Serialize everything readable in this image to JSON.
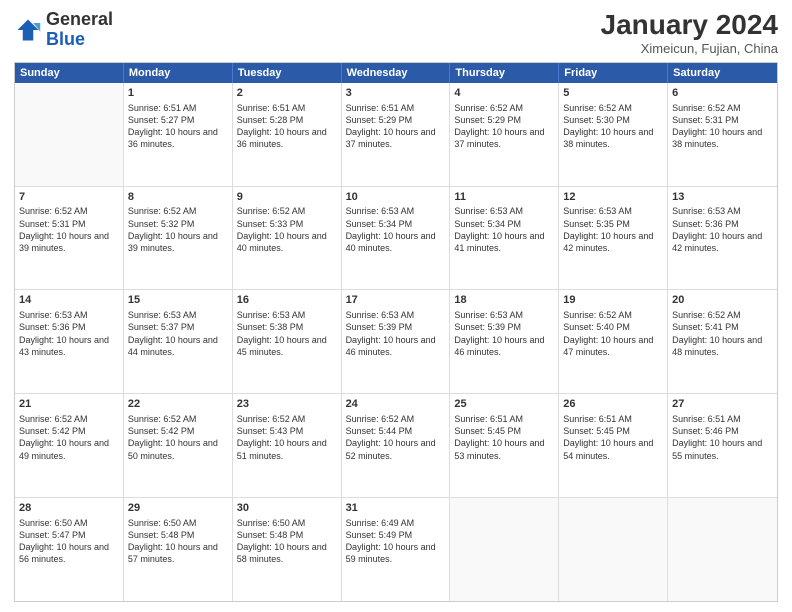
{
  "header": {
    "logo_general": "General",
    "logo_blue": "Blue",
    "month_year": "January 2024",
    "location": "Ximeicun, Fujian, China"
  },
  "weekdays": [
    "Sunday",
    "Monday",
    "Tuesday",
    "Wednesday",
    "Thursday",
    "Friday",
    "Saturday"
  ],
  "rows": [
    [
      {
        "day": "",
        "sunrise": "",
        "sunset": "",
        "daylight": ""
      },
      {
        "day": "1",
        "sunrise": "Sunrise: 6:51 AM",
        "sunset": "Sunset: 5:27 PM",
        "daylight": "Daylight: 10 hours and 36 minutes."
      },
      {
        "day": "2",
        "sunrise": "Sunrise: 6:51 AM",
        "sunset": "Sunset: 5:28 PM",
        "daylight": "Daylight: 10 hours and 36 minutes."
      },
      {
        "day": "3",
        "sunrise": "Sunrise: 6:51 AM",
        "sunset": "Sunset: 5:29 PM",
        "daylight": "Daylight: 10 hours and 37 minutes."
      },
      {
        "day": "4",
        "sunrise": "Sunrise: 6:52 AM",
        "sunset": "Sunset: 5:29 PM",
        "daylight": "Daylight: 10 hours and 37 minutes."
      },
      {
        "day": "5",
        "sunrise": "Sunrise: 6:52 AM",
        "sunset": "Sunset: 5:30 PM",
        "daylight": "Daylight: 10 hours and 38 minutes."
      },
      {
        "day": "6",
        "sunrise": "Sunrise: 6:52 AM",
        "sunset": "Sunset: 5:31 PM",
        "daylight": "Daylight: 10 hours and 38 minutes."
      }
    ],
    [
      {
        "day": "7",
        "sunrise": "Sunrise: 6:52 AM",
        "sunset": "Sunset: 5:31 PM",
        "daylight": "Daylight: 10 hours and 39 minutes."
      },
      {
        "day": "8",
        "sunrise": "Sunrise: 6:52 AM",
        "sunset": "Sunset: 5:32 PM",
        "daylight": "Daylight: 10 hours and 39 minutes."
      },
      {
        "day": "9",
        "sunrise": "Sunrise: 6:52 AM",
        "sunset": "Sunset: 5:33 PM",
        "daylight": "Daylight: 10 hours and 40 minutes."
      },
      {
        "day": "10",
        "sunrise": "Sunrise: 6:53 AM",
        "sunset": "Sunset: 5:34 PM",
        "daylight": "Daylight: 10 hours and 40 minutes."
      },
      {
        "day": "11",
        "sunrise": "Sunrise: 6:53 AM",
        "sunset": "Sunset: 5:34 PM",
        "daylight": "Daylight: 10 hours and 41 minutes."
      },
      {
        "day": "12",
        "sunrise": "Sunrise: 6:53 AM",
        "sunset": "Sunset: 5:35 PM",
        "daylight": "Daylight: 10 hours and 42 minutes."
      },
      {
        "day": "13",
        "sunrise": "Sunrise: 6:53 AM",
        "sunset": "Sunset: 5:36 PM",
        "daylight": "Daylight: 10 hours and 42 minutes."
      }
    ],
    [
      {
        "day": "14",
        "sunrise": "Sunrise: 6:53 AM",
        "sunset": "Sunset: 5:36 PM",
        "daylight": "Daylight: 10 hours and 43 minutes."
      },
      {
        "day": "15",
        "sunrise": "Sunrise: 6:53 AM",
        "sunset": "Sunset: 5:37 PM",
        "daylight": "Daylight: 10 hours and 44 minutes."
      },
      {
        "day": "16",
        "sunrise": "Sunrise: 6:53 AM",
        "sunset": "Sunset: 5:38 PM",
        "daylight": "Daylight: 10 hours and 45 minutes."
      },
      {
        "day": "17",
        "sunrise": "Sunrise: 6:53 AM",
        "sunset": "Sunset: 5:39 PM",
        "daylight": "Daylight: 10 hours and 46 minutes."
      },
      {
        "day": "18",
        "sunrise": "Sunrise: 6:53 AM",
        "sunset": "Sunset: 5:39 PM",
        "daylight": "Daylight: 10 hours and 46 minutes."
      },
      {
        "day": "19",
        "sunrise": "Sunrise: 6:52 AM",
        "sunset": "Sunset: 5:40 PM",
        "daylight": "Daylight: 10 hours and 47 minutes."
      },
      {
        "day": "20",
        "sunrise": "Sunrise: 6:52 AM",
        "sunset": "Sunset: 5:41 PM",
        "daylight": "Daylight: 10 hours and 48 minutes."
      }
    ],
    [
      {
        "day": "21",
        "sunrise": "Sunrise: 6:52 AM",
        "sunset": "Sunset: 5:42 PM",
        "daylight": "Daylight: 10 hours and 49 minutes."
      },
      {
        "day": "22",
        "sunrise": "Sunrise: 6:52 AM",
        "sunset": "Sunset: 5:42 PM",
        "daylight": "Daylight: 10 hours and 50 minutes."
      },
      {
        "day": "23",
        "sunrise": "Sunrise: 6:52 AM",
        "sunset": "Sunset: 5:43 PM",
        "daylight": "Daylight: 10 hours and 51 minutes."
      },
      {
        "day": "24",
        "sunrise": "Sunrise: 6:52 AM",
        "sunset": "Sunset: 5:44 PM",
        "daylight": "Daylight: 10 hours and 52 minutes."
      },
      {
        "day": "25",
        "sunrise": "Sunrise: 6:51 AM",
        "sunset": "Sunset: 5:45 PM",
        "daylight": "Daylight: 10 hours and 53 minutes."
      },
      {
        "day": "26",
        "sunrise": "Sunrise: 6:51 AM",
        "sunset": "Sunset: 5:45 PM",
        "daylight": "Daylight: 10 hours and 54 minutes."
      },
      {
        "day": "27",
        "sunrise": "Sunrise: 6:51 AM",
        "sunset": "Sunset: 5:46 PM",
        "daylight": "Daylight: 10 hours and 55 minutes."
      }
    ],
    [
      {
        "day": "28",
        "sunrise": "Sunrise: 6:50 AM",
        "sunset": "Sunset: 5:47 PM",
        "daylight": "Daylight: 10 hours and 56 minutes."
      },
      {
        "day": "29",
        "sunrise": "Sunrise: 6:50 AM",
        "sunset": "Sunset: 5:48 PM",
        "daylight": "Daylight: 10 hours and 57 minutes."
      },
      {
        "day": "30",
        "sunrise": "Sunrise: 6:50 AM",
        "sunset": "Sunset: 5:48 PM",
        "daylight": "Daylight: 10 hours and 58 minutes."
      },
      {
        "day": "31",
        "sunrise": "Sunrise: 6:49 AM",
        "sunset": "Sunset: 5:49 PM",
        "daylight": "Daylight: 10 hours and 59 minutes."
      },
      {
        "day": "",
        "sunrise": "",
        "sunset": "",
        "daylight": ""
      },
      {
        "day": "",
        "sunrise": "",
        "sunset": "",
        "daylight": ""
      },
      {
        "day": "",
        "sunrise": "",
        "sunset": "",
        "daylight": ""
      }
    ]
  ]
}
